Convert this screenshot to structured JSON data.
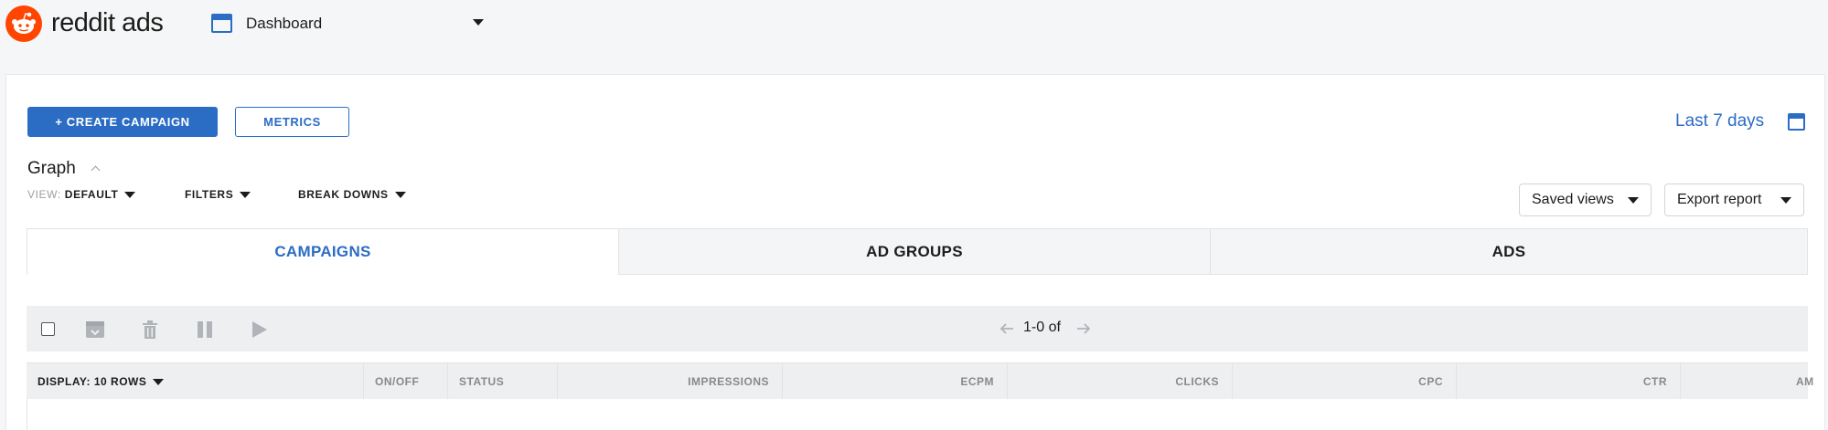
{
  "header": {
    "brand": "reddit ads",
    "nav_label": "Dashboard"
  },
  "toolbar": {
    "create_label": "+ CREATE CAMPAIGN",
    "metrics_label": "METRICS",
    "date_range": "Last 7 days"
  },
  "graph": {
    "title": "Graph",
    "view_prefix": "VIEW:",
    "view_value": "DEFAULT",
    "filters_label": "FILTERS",
    "breakdowns_label": "BREAK DOWNS",
    "saved_views_label": "Saved views",
    "export_label": "Export report"
  },
  "tabs": [
    {
      "label": "CAMPAIGNS",
      "active": true
    },
    {
      "label": "AD GROUPS",
      "active": false
    },
    {
      "label": "ADS",
      "active": false
    }
  ],
  "table": {
    "pager": "1-0 of",
    "display_label": "DISPLAY: 10 ROWS",
    "columns": [
      "ON/OFF",
      "STATUS",
      "IMPRESSIONS",
      "ECPM",
      "CLICKS",
      "CPC",
      "CTR",
      "AM"
    ]
  },
  "colors": {
    "accent": "#2b6cc4",
    "brand": "#ff4500"
  }
}
